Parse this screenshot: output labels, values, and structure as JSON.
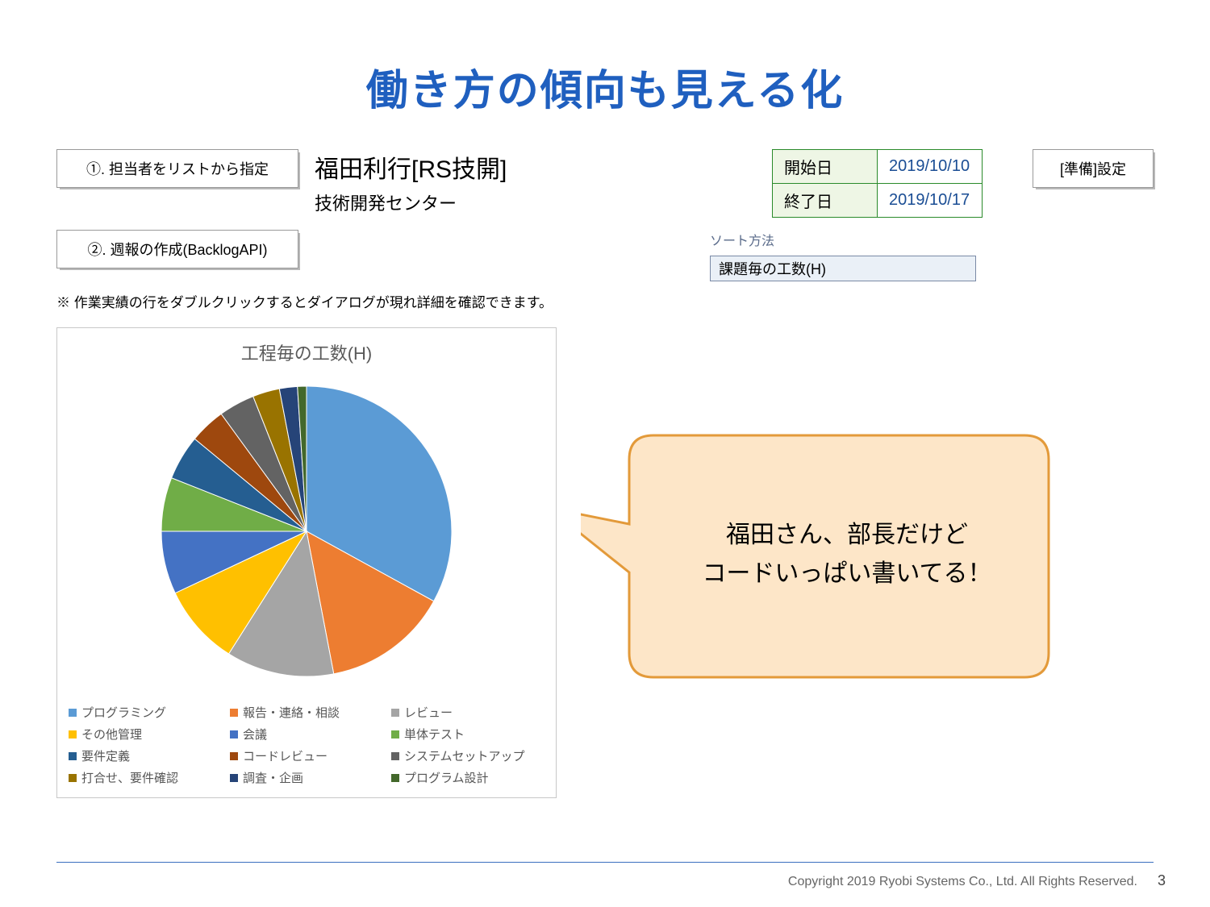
{
  "title": "働き方の傾向も見える化",
  "buttons": {
    "b1": "①. 担当者をリストから指定",
    "b2": "②. 週報の作成(BacklogAPI)",
    "b3": "[準備]設定"
  },
  "person": {
    "name": "福田利行[RS技開]",
    "dept": "技術開発センター"
  },
  "dates": {
    "startLabel": "開始日",
    "startVal": "2019/10/10",
    "endLabel": "終了日",
    "endVal": "2019/10/17"
  },
  "note": "※ 作業実績の行をダブルクリックするとダイアログが現れ詳細を確認できます。",
  "sort": {
    "label": "ソート方法",
    "value": "課題毎の工数(H)"
  },
  "callout": {
    "l1": "福田さん、部長だけど",
    "l2": "コードいっぱい書いてる！"
  },
  "chart_data": {
    "type": "pie",
    "title": "工程毎の工数(H)",
    "series": [
      {
        "name": "プログラミング",
        "value": 33,
        "color": "#5b9bd5"
      },
      {
        "name": "報告・連絡・相談",
        "value": 14,
        "color": "#ed7d31"
      },
      {
        "name": "レビュー",
        "value": 12,
        "color": "#a5a5a5"
      },
      {
        "name": "その他管理",
        "value": 9,
        "color": "#ffc000"
      },
      {
        "name": "会議",
        "value": 7,
        "color": "#4472c4"
      },
      {
        "name": "単体テスト",
        "value": 6,
        "color": "#70ad47"
      },
      {
        "name": "要件定義",
        "value": 5,
        "color": "#255e91"
      },
      {
        "name": "コードレビュー",
        "value": 4,
        "color": "#9e480e"
      },
      {
        "name": "システムセットアップ",
        "value": 4,
        "color": "#636363"
      },
      {
        "name": "打合せ、要件確認",
        "value": 3,
        "color": "#997300"
      },
      {
        "name": "調査・企画",
        "value": 2,
        "color": "#264478"
      },
      {
        "name": "プログラム設計",
        "value": 1,
        "color": "#43682b"
      }
    ]
  },
  "footer": {
    "copyright": "Copyright 2019 Ryobi Systems Co., Ltd. All Rights Reserved.",
    "page": "3"
  }
}
